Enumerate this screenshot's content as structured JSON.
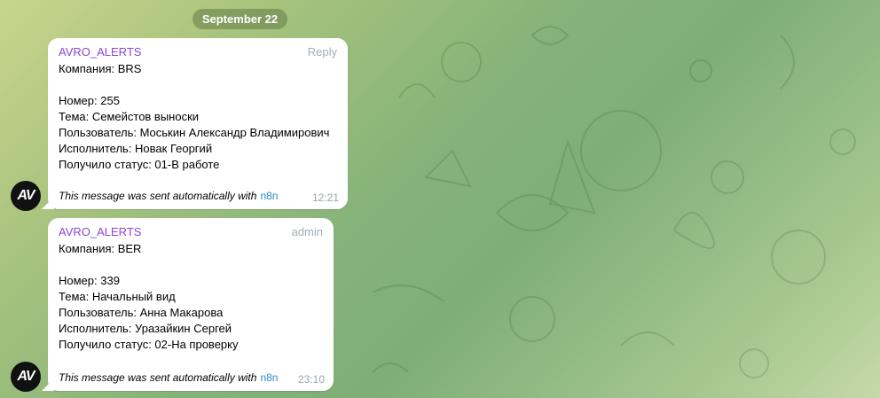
{
  "date": "September 22",
  "messages": [
    {
      "sender": "AVRO_ALERTS",
      "tag": "Reply",
      "lines": [
        "Компания: BRS",
        "",
        "Номер: 255",
        "Тема: Семейстов выноски",
        "Пользователь: Моськин Александр Владимирович",
        "Исполнитель: Новак Георгий",
        "Получило статус: 01-В работе"
      ],
      "footer_text": "This message was sent automatically with",
      "footer_link": "n8n",
      "time": "12:21",
      "avatar_text": "AV"
    },
    {
      "sender": "AVRO_ALERTS",
      "tag": "admin",
      "lines": [
        "Компания: BER",
        "",
        "Номер: 339",
        "Тема: Начальный вид",
        "Пользователь: Анна Макарова",
        "Исполнитель: Уразайкин Сергей",
        "Получило статус: 02-На проверку"
      ],
      "footer_text": "This message was sent automatically with",
      "footer_link": "n8n",
      "time": "23:10",
      "avatar_text": "AV"
    }
  ]
}
